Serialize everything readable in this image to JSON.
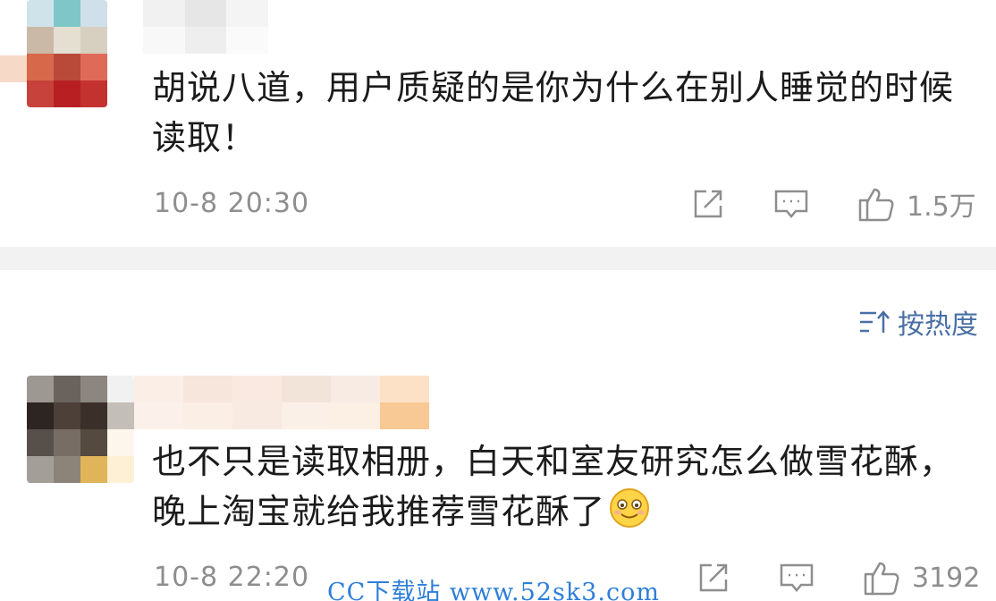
{
  "comments": [
    {
      "text": "胡说八道，用户质疑的是你为什么在别人睡觉的时候读取！",
      "time": "10-8 20:30",
      "like_count": "1.5万",
      "icons": {
        "share": "share-icon",
        "reply": "comment-icon",
        "like": "thumbs-up-icon"
      }
    },
    {
      "text": "也不只是读取相册，白天和室友研究怎么做雪花酥，晚上淘宝就给我推荐雪花酥了",
      "time": "10-8 22:20",
      "like_count": "3192",
      "icons": {
        "share": "share-icon",
        "reply": "comment-icon",
        "like": "thumbs-up-icon",
        "emoji": "smiling-face-emoji"
      }
    }
  ],
  "sort": {
    "label": "按热度",
    "icon": "sort-icon"
  },
  "watermark": "CC下载站 www.52sk3.com",
  "colors": {
    "meta_gray": "#8e8e8e",
    "sort_blue": "#4a6fa5",
    "watermark_blue": "#2e7fd9",
    "divider": "#f2f2f2"
  }
}
